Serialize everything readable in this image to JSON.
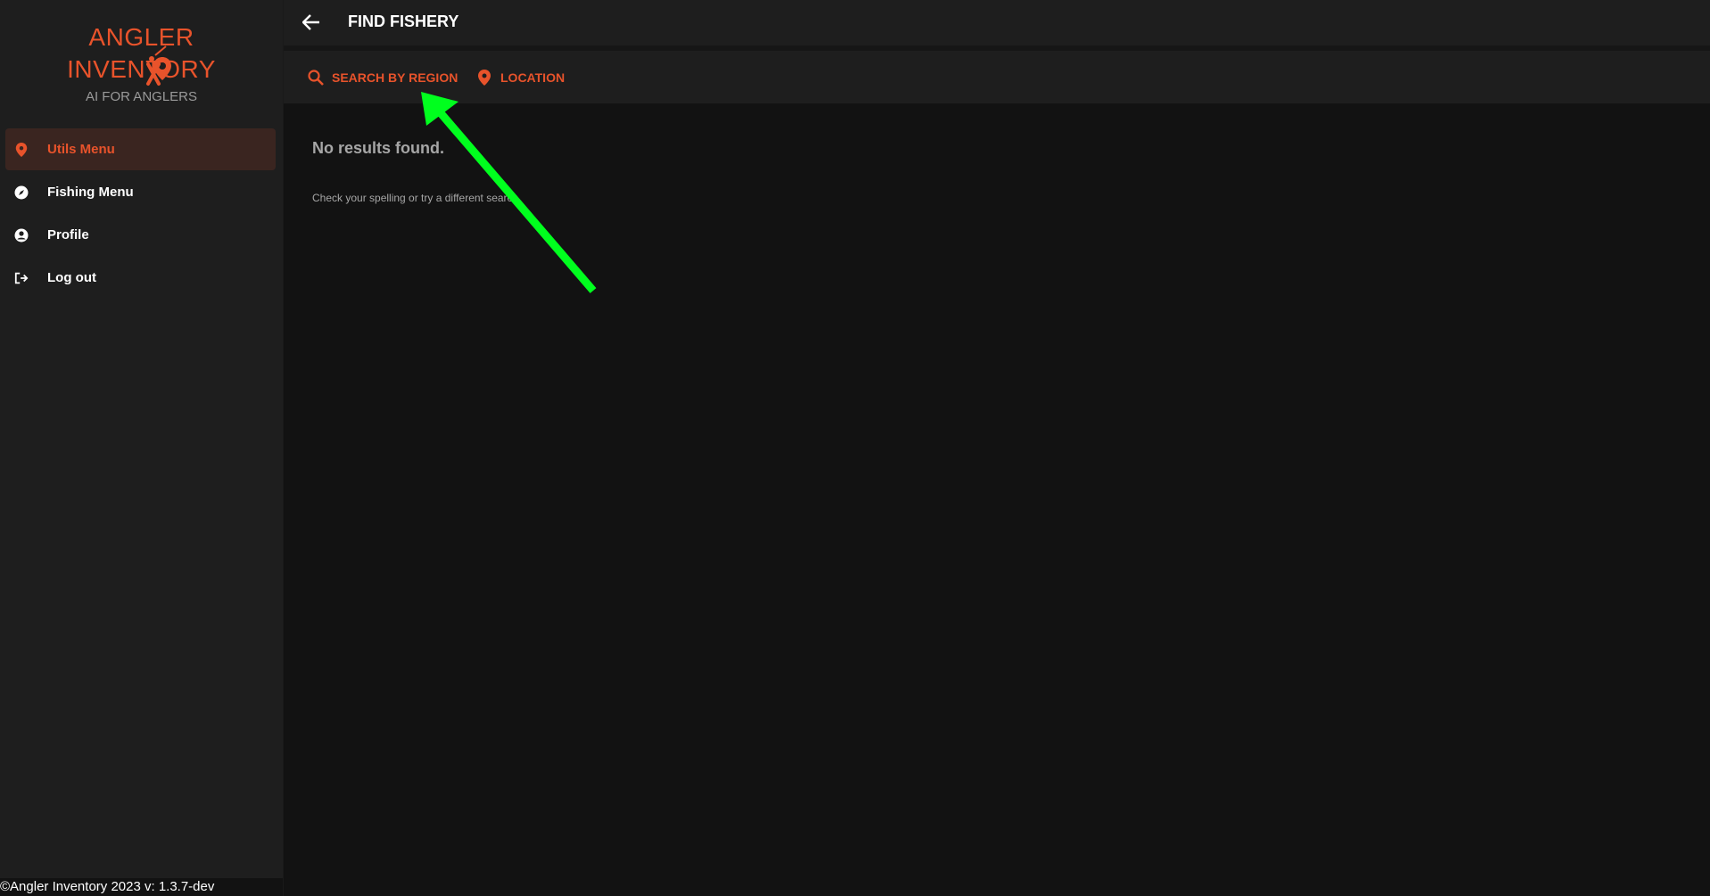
{
  "app": {
    "logo_line1": "ANGLER",
    "logo_line2": "INVENTORY",
    "tagline": "AI FOR ANGLERS",
    "accent_color": "#e8532b"
  },
  "sidebar": {
    "items": [
      {
        "label": "Utils Menu",
        "icon": "map-pin-icon",
        "active": true
      },
      {
        "label": "Fishing Menu",
        "icon": "compass-icon",
        "active": false
      },
      {
        "label": "Profile",
        "icon": "user-circle-icon",
        "active": false
      },
      {
        "label": "Log out",
        "icon": "logout-icon",
        "active": false
      }
    ],
    "footer": "©Angler Inventory 2023 v: 1.3.7-dev"
  },
  "header": {
    "title": "FIND FISHERY",
    "back_icon": "arrow-left-icon"
  },
  "tabs": [
    {
      "label": "SEARCH BY REGION",
      "icon": "search-icon"
    },
    {
      "label": "LOCATION",
      "icon": "map-pin-icon"
    }
  ],
  "results": {
    "empty_title": "No results found.",
    "empty_hint": "Check your spelling or try a different search."
  },
  "annotation": {
    "arrow_color": "#00ff1e",
    "arrow_icon": "green-arrow-annotation"
  }
}
